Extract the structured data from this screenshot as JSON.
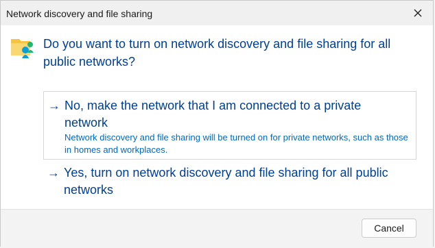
{
  "window": {
    "title": "Network discovery and file sharing"
  },
  "icons": {
    "close": "close-icon",
    "main": "network-folder-icon",
    "option_arrow": "arrow-right-icon"
  },
  "main": {
    "question": "Do you want to turn on network discovery and file sharing for all public networks?"
  },
  "options": [
    {
      "arrow": "→",
      "title": "No, make the network that I am connected to a private network",
      "description": "Network discovery and file sharing will be turned on for private networks, such as those in homes and workplaces."
    },
    {
      "arrow": "→",
      "title": "Yes, turn on network discovery and file sharing for all public networks",
      "description": ""
    }
  ],
  "footer": {
    "cancel_label": "Cancel"
  },
  "colors": {
    "heading": "#003e92",
    "description": "#0067c0",
    "titlebar": "#f0f0f0",
    "footer": "#f3f3f3"
  }
}
